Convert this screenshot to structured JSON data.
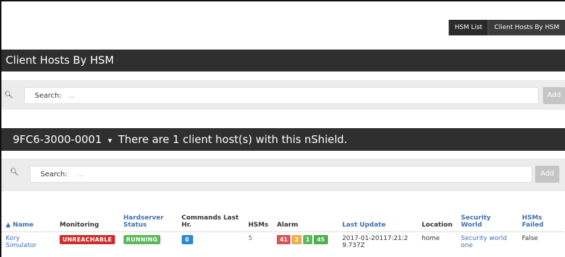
{
  "nav": {
    "hsm_list": "HSM List",
    "client_hosts": "Client Hosts By HSM"
  },
  "page_title": "Client Hosts By HSM",
  "search_top": {
    "label": "Search:",
    "placeholder": "...",
    "add_label": "Add"
  },
  "hsm_header": {
    "serial": "9FC6-3000-0001",
    "caret": "▾",
    "message": "There are 1 client host(s) with this nShield."
  },
  "search_inner": {
    "label": "Search:",
    "placeholder": "...",
    "add_label": "Add"
  },
  "table": {
    "headers": {
      "name": "▲ Name",
      "monitoring": "Monitoring",
      "hardserver": "Hardserver Status",
      "commands": "Commands Last Hr.",
      "hsms": "HSMs",
      "alarm": "Alarm",
      "last_update": "Last Update",
      "location": "Location",
      "security_world": "Security World",
      "hsms_failed": "HSMs Failed"
    },
    "rows": [
      {
        "name": "Kory Simulator",
        "monitoring": "UNREACHABLE",
        "hardserver": "RUNNING",
        "commands": "0",
        "hsms": "5",
        "alarm": [
          "41",
          "2",
          "1",
          "45"
        ],
        "last_update": "2017-01-20117:21:29.737Z",
        "location": "home",
        "security_world": "Security world one",
        "hsms_failed": "False"
      }
    ]
  },
  "colors": {
    "dark_bar": "#2f2f2f",
    "link": "#3f6fb3",
    "unreachable": "#c9302c",
    "running": "#5cb85c",
    "commands_badge": "#2e8ad0"
  }
}
